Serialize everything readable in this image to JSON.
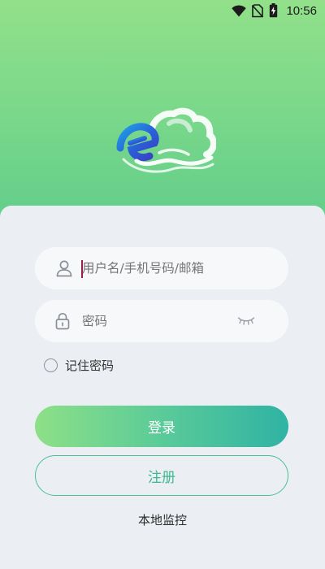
{
  "status_bar": {
    "time": "10:56",
    "icons": [
      "wifi-icon",
      "no-sim-icon",
      "battery-charging-icon"
    ]
  },
  "logo": {
    "name": "cloud-e-logo"
  },
  "login_form": {
    "username_placeholder": "用户名/手机号码/邮箱",
    "password_placeholder": "密码",
    "remember_label": "记住密码",
    "remember_checked": false,
    "login_label": "登录",
    "register_label": "注册",
    "local_monitor_label": "本地监控"
  },
  "colors": {
    "header_gradient_top": "#92e08a",
    "header_gradient_bottom": "#5fcb8b",
    "card_background": "#ebeff3",
    "login_gradient_start": "#8ee087",
    "login_gradient_end": "#2fb3a4",
    "register_text": "#3cb88d"
  }
}
